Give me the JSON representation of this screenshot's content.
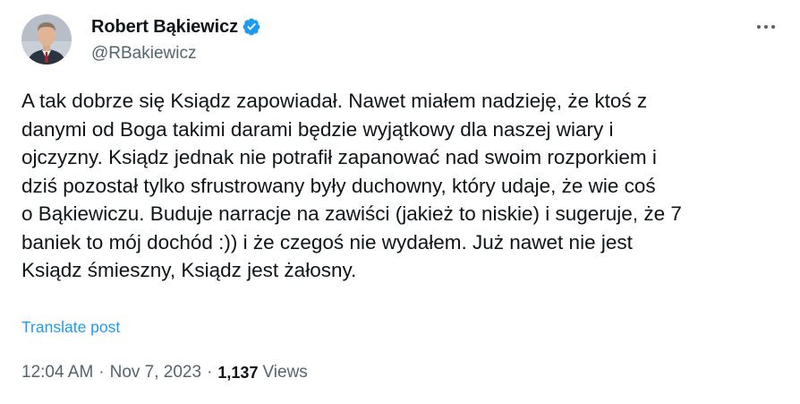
{
  "author": {
    "display_name": "Robert Bąkiewicz",
    "handle": "@RBakiewicz",
    "verified": true
  },
  "post": {
    "lines": [
      "A tak dobrze się Ksiądz zapowiadał. Nawet miałem nadzieję, że ktoś z",
      "danymi od Boga takimi darami będzie wyjątkowy dla naszej wiary i",
      "ojczyzny. Ksiądz jednak nie potrafił zapanować nad swoim rozporkiem i",
      "dziś pozostał tylko sfrustrowany były duchowny, który udaje, że wie coś",
      "o Bąkiewiczu. Buduje narracje na zawiści (jakież to niskie) i sugeruje, że 7",
      "baniek to mój dochód :)) i że czegoś nie wydałem. Już nawet nie jest",
      "Ksiądz śmieszny, Ksiądz jest żałosny."
    ],
    "translate_label": "Translate post"
  },
  "meta": {
    "time": "12:04 AM",
    "date": "Nov 7, 2023",
    "separator": "·",
    "views_count": "1,137",
    "views_label": "Views"
  },
  "colors": {
    "text": "#0f1419",
    "secondary": "#536471",
    "link": "#1d9bf0",
    "verified": "#1d9bf0"
  },
  "icons": {
    "verified": "verified-badge-icon",
    "more": "more-options-icon"
  }
}
